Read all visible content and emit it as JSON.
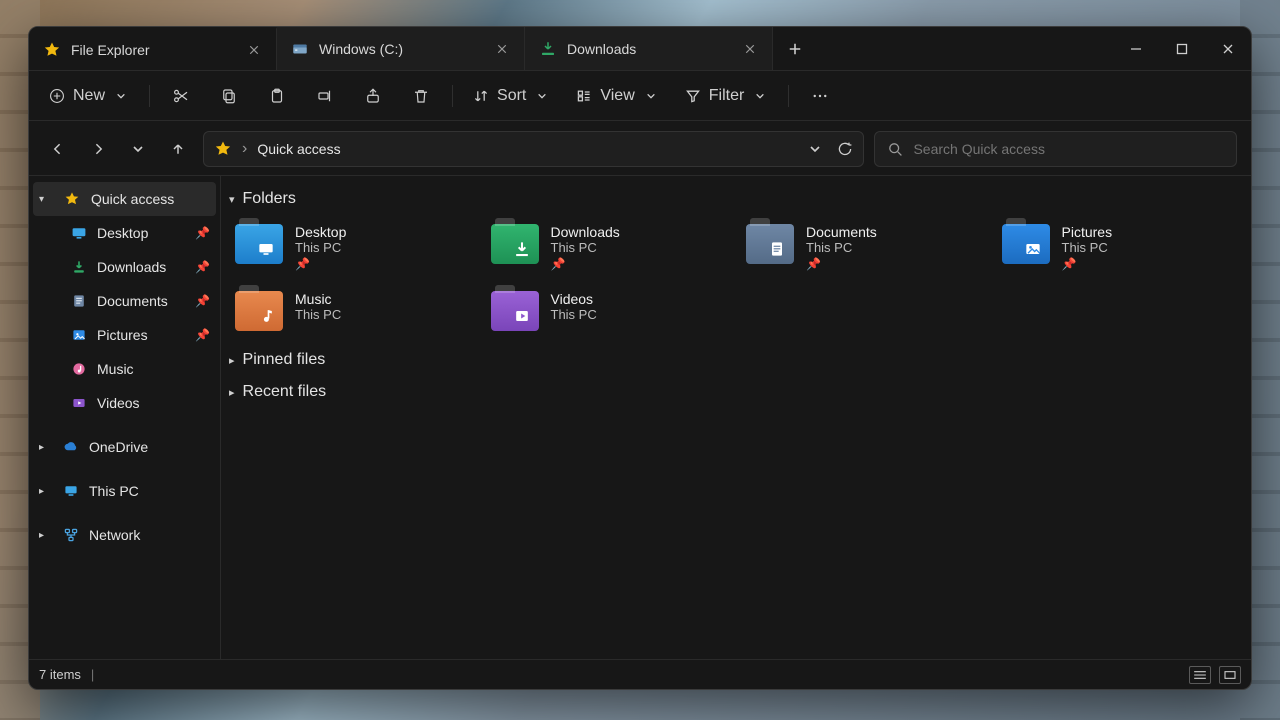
{
  "window": {
    "tabs": [
      {
        "label": "File Explorer",
        "icon": "star"
      },
      {
        "label": "Windows (C:)",
        "icon": "drive"
      },
      {
        "label": "Downloads",
        "icon": "download"
      }
    ]
  },
  "toolbar": {
    "new_label": "New",
    "sort_label": "Sort",
    "view_label": "View",
    "filter_label": "Filter"
  },
  "address": {
    "crumb": "Quick access"
  },
  "search": {
    "placeholder": "Search Quick access"
  },
  "sidebar": {
    "quick_access": "Quick access",
    "items": [
      {
        "label": "Desktop",
        "icon": "desktop",
        "pinned": true
      },
      {
        "label": "Downloads",
        "icon": "download",
        "pinned": true
      },
      {
        "label": "Documents",
        "icon": "document",
        "pinned": true
      },
      {
        "label": "Pictures",
        "icon": "picture",
        "pinned": true
      },
      {
        "label": "Music",
        "icon": "music",
        "pinned": false
      },
      {
        "label": "Videos",
        "icon": "video",
        "pinned": false
      }
    ],
    "roots": [
      {
        "label": "OneDrive"
      },
      {
        "label": "This PC"
      },
      {
        "label": "Network"
      }
    ]
  },
  "content": {
    "group_folders": "Folders",
    "group_pinned": "Pinned files",
    "group_recent": "Recent files",
    "folders": [
      {
        "name": "Desktop",
        "sub": "This PC",
        "color": "blue",
        "glyph": "monitor"
      },
      {
        "name": "Downloads",
        "sub": "This PC",
        "color": "green",
        "glyph": "download"
      },
      {
        "name": "Documents",
        "sub": "This PC",
        "color": "steel",
        "glyph": "doc"
      },
      {
        "name": "Pictures",
        "sub": "This PC",
        "color": "sky",
        "glyph": "image"
      },
      {
        "name": "Music",
        "sub": "This PC",
        "color": "orange",
        "glyph": "note"
      },
      {
        "name": "Videos",
        "sub": "This PC",
        "color": "purple",
        "glyph": "play"
      }
    ]
  },
  "status": {
    "items_text": "7 items"
  }
}
